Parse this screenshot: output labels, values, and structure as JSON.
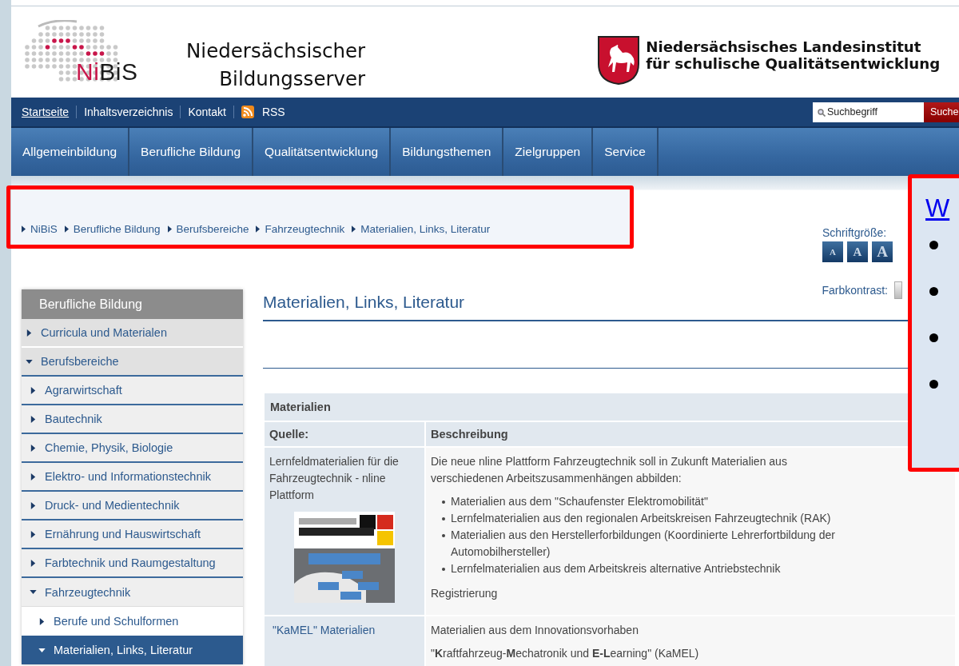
{
  "header": {
    "logo": {
      "part_1": "Ni",
      "part_2": "BiS"
    },
    "site_title": [
      "Niedersächsischer",
      "Bildungsserver"
    ],
    "institute": [
      "Niedersächsisches Landesinstitut",
      "für schulische Qualitätsentwicklung"
    ]
  },
  "top_bar": {
    "links": [
      {
        "label": "Startseite",
        "kind": "underlined"
      },
      {
        "label": "Inhaltsverzeichnis",
        "kind": "plain"
      },
      {
        "label": "Kontakt",
        "kind": "plain"
      },
      {
        "label": "RSS",
        "kind": "rss"
      }
    ],
    "search": {
      "placeholder": "Suchbegriff"
    },
    "search_button": "Suche"
  },
  "main_nav": [
    "Allgemeinbildung",
    "Berufliche Bildung",
    "Qualitätsentwicklung",
    "Bildungsthemen",
    "Zielgruppen",
    "Service"
  ],
  "breadcrumb": [
    "NiBiS",
    "Berufliche Bildung",
    "Berufsbereiche",
    "Fahrzeugtechnik",
    "Materialien, Links, Literatur"
  ],
  "font_size": {
    "label": "Schriftgröße:",
    "buttons": [
      "A",
      "A",
      "A"
    ]
  },
  "contrast": {
    "label": "Farbkontrast:"
  },
  "sidebar": {
    "title": "Berufliche Bildung",
    "items": [
      {
        "label": "Curricula und Materialen",
        "expanded": false,
        "selected": false
      },
      {
        "label": "Berufsbereiche",
        "expanded": true,
        "selected": false,
        "children": [
          {
            "label": "Agrarwirtschaft",
            "expanded": false,
            "selected": false
          },
          {
            "label": "Bautechnik",
            "expanded": false,
            "selected": false
          },
          {
            "label": "Chemie, Physik, Biologie",
            "expanded": false,
            "selected": false
          },
          {
            "label": "Elektro- und Informationstechnik",
            "expanded": false,
            "selected": false
          },
          {
            "label": "Druck- und Medientechnik",
            "expanded": false,
            "selected": false
          },
          {
            "label": "Ernährung und Hauswirtschaft",
            "expanded": false,
            "selected": false
          },
          {
            "label": "Farbtechnik und Raumgestaltung",
            "expanded": false,
            "selected": false
          },
          {
            "label": "Fahrzeugtechnik",
            "expanded": true,
            "selected": false,
            "children": [
              {
                "label": "Berufe und Schulformen",
                "expanded": false,
                "selected": false
              },
              {
                "label": "Materialien, Links, Literatur",
                "expanded": true,
                "selected": true
              }
            ]
          }
        ]
      }
    ]
  },
  "page_title": "Materialien, Links, Literatur",
  "table": {
    "caption": "Materialien",
    "columns": [
      "Quelle:",
      "Beschreibung"
    ],
    "rows": [
      {
        "source": {
          "kind": "text",
          "text": "Lernfeldmaterialien für die Fahrzeugtechnik - nline Plattform"
        },
        "source_image": true,
        "description": [
          {
            "kind": "paragraph",
            "text": "Die neue nline Plattform Fahrzeugtechnik soll in Zukunft Materialien aus verschiedenen Arbeitszusammenhängen abbilden:"
          },
          {
            "kind": "list",
            "items": [
              "Materialien aus dem \"Schaufenster Elektromobilität\"",
              "Lernfelmaterialien aus den regionalen Arbeitskreisen Fahrzeugtechnik (RAK)",
              "Materialien aus den Herstellerforbildungen (Koordinierte Lehrerfortbildung der Automobilhersteller)",
              "Lernfelmaterialien aus dem Arbeitskreis alternative Antriebstechnik"
            ]
          },
          {
            "kind": "paragraph",
            "text": "Registrierung"
          }
        ]
      },
      {
        "source": {
          "kind": "link",
          "text": "\"KaMEL\" Materialien"
        },
        "source_image": false,
        "description": [
          {
            "kind": "paragraph",
            "text": "Materialien aus dem Innovationsvorhaben"
          },
          {
            "kind": "paragraph",
            "text": "\"**K**raftfahrzeug-**M**echatronik und **E-L**earning\" (KaMEL)"
          }
        ]
      }
    ]
  },
  "callout": {
    "link": "W",
    "bullets": [
      {
        "kind": "dot"
      },
      {
        "kind": "dot"
      },
      {
        "kind": "dot"
      },
      {
        "kind": "dot"
      }
    ]
  }
}
